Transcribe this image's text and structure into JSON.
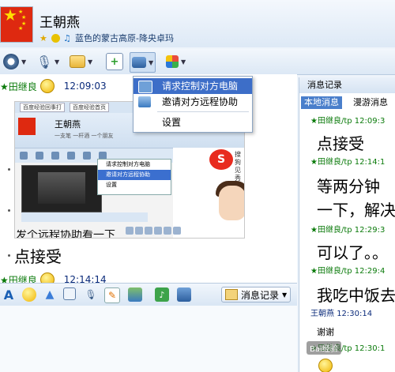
{
  "contact": {
    "name": "王朝燕",
    "signature": "蓝色的蒙古高原-降央卓玛"
  },
  "toolbar": {
    "icons": [
      "camera-icon",
      "microphone-icon",
      "folder-icon",
      "add-app-icon",
      "remote-desktop-icon",
      "apps-grid-icon"
    ]
  },
  "remote_menu": {
    "items": [
      "请求控制对方电脑",
      "邀请对方远程协助",
      "设置"
    ]
  },
  "chat": {
    "msg1_sender": "★田继良",
    "msg1_time": "12:09:03",
    "embedded": {
      "tab1": "百度经验回事打",
      "tab2": "百度经验首页",
      "name": "王朝燕",
      "signature": "一支笔 一杆酒 一个朋友",
      "menu": [
        "请求控制对方电脑",
        "邀请对方远程协助",
        "设置"
      ],
      "sohu": "S",
      "sohu_text": "搜狗",
      "sohu_text2": "见秀"
    },
    "msg_partial": "发个远程协助看一下",
    "msg_accept": "点接受",
    "msg2_sender": "★田继良",
    "msg2_time": "12:14:14"
  },
  "input_toolbar": {
    "history_label": "消息记录"
  },
  "history_panel": {
    "title": "消息记录",
    "tab_local": "本地消息",
    "tab_roam": "漫游消息",
    "entries": [
      {
        "sender": "★田继良/tp",
        "time": "12:09:3"
      },
      {
        "text": "点接受"
      },
      {
        "sender": "★田继良/tp",
        "time": "12:14:1"
      },
      {
        "text": "等两分钟"
      },
      {
        "text": "一下，解决"
      },
      {
        "sender": "★田继良/tp",
        "time": "12:29:3"
      },
      {
        "text": "可以了。。"
      },
      {
        "sender": "★田继良/tp",
        "time": "12:29:4"
      },
      {
        "text": "我吃中饭去"
      },
      {
        "sender": "王朝燕",
        "time": "12:30:14"
      },
      {
        "text": "谢谢"
      },
      {
        "sender": "★田继良/tp",
        "time": "12:30:1"
      }
    ]
  },
  "watermark": "Bai经验"
}
